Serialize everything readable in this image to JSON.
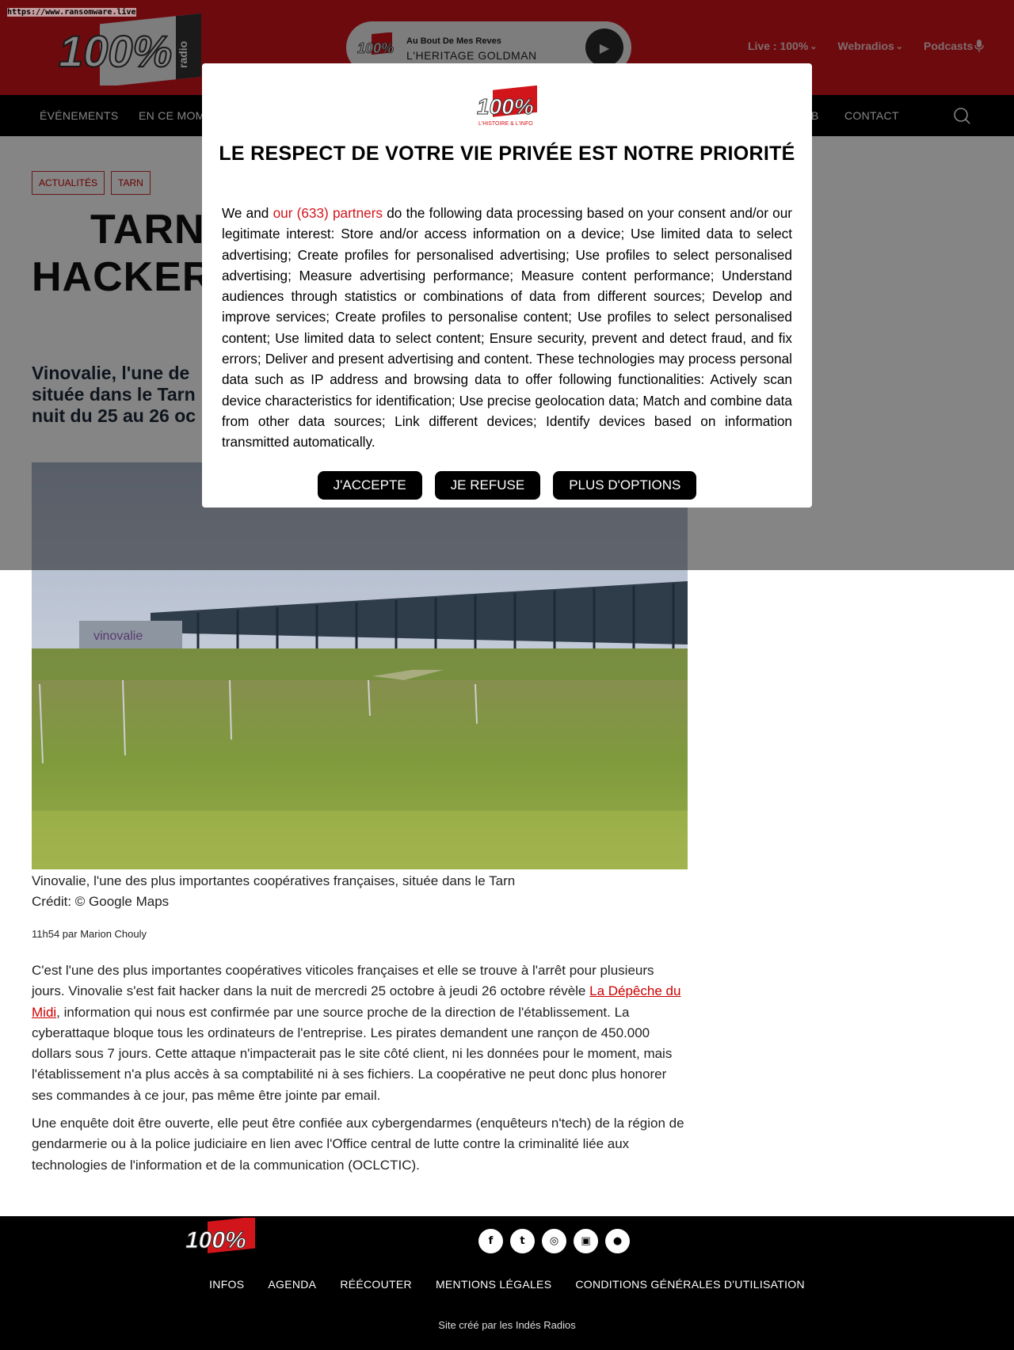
{
  "page": {
    "url_label": "https://www.ransomware.live"
  },
  "header": {
    "logo_text": "100%",
    "logo_sub": "radio",
    "player": {
      "logo_text": "100%",
      "song": "Au Bout De Mes Reves",
      "artist": "L'HERITAGE GOLDMAN",
      "play_symbol": "▶"
    },
    "links": [
      {
        "label": "Live : 100%",
        "icon": "chevron-down-icon"
      },
      {
        "label": "Webradios",
        "icon": "chevron-down-icon"
      },
      {
        "label": "Podcasts",
        "icon": "microphone-icon"
      }
    ]
  },
  "nav": {
    "items": [
      "ÉVÉNEMENTS",
      "EN CE MOM",
      "B",
      "CONTACT"
    ],
    "search_icon": "search-icon"
  },
  "article": {
    "tags": [
      "ACTUALITÉS",
      "TARN"
    ],
    "headline_lines": [
      "TARN. V",
      "HACKERS,"
    ],
    "lead_lines": [
      "Vinovalie, l'une de",
      "située dans le Tarn",
      "nuit du 25 au 26 oc"
    ],
    "photo_alt_label": "vinovalie",
    "caption": "Vinovalie, l'une des plus importantes coopératives françaises, située dans le Tarn",
    "credit": "Crédit: © Google Maps",
    "byline": "11h54 par Marion Chouly",
    "p1_a": "C'est l'une des plus importantes coopératives viticoles françaises et elle se trouve à l'arrêt pour plusieurs jours. Vinovalie s'est fait hacker dans la nuit de mercredi 25 octobre à jeudi 26 octobre révèle ",
    "p1_link": "La Dépêche du Midi",
    "p1_b": ", information qui nous est confirmée par une source proche de la direction de l'établissement. La cyberattaque bloque tous les ordinateurs de l'entreprise. Les pirates demandent une rançon de 450.000 dollars sous 7 jours. Cette attaque n'impacterait pas le site côté client, ni les données pour le moment, mais l'établissement n'a plus accès à sa comptabilité ni à ses fichiers. La coopérative ne peut donc plus honorer ses commandes à ce jour, pas même être jointe par email.",
    "p2": "Une enquête doit être ouverte, elle peut être confiée aux cybergendarmes (enquêteurs n'tech) de la région de gendarmerie ou à la police judiciaire en lien avec l'Office central de lutte contre la criminalité liée aux technologies de l'information et de la communication (OCLCTIC)."
  },
  "consent": {
    "logo_text": "100%",
    "logo_sub": "L'HISTOIRE & L'INFO",
    "title": "LE RESPECT DE VOTRE VIE PRIVÉE EST NOTRE PRIORITÉ",
    "text_before": "We and ",
    "partners_link": "our (633) partners",
    "text_after": " do the following data processing based on your consent and/or our legitimate interest: Store and/or access information on a device; Use limited data to select advertising; Create profiles for personalised advertising; Use profiles to select personalised advertising; Measure advertising performance; Measure content performance; Understand audiences through statistics or combinations of data from different sources; Develop and improve services; Create profiles to personalise content; Use profiles to select personalised content; Use limited data to select content; Ensure security, prevent and detect fraud, and fix errors; Deliver and present advertising and content. These technologies may process personal data such as IP address and browsing data to offer following functionalities: Actively scan device characteristics for identification; Use precise geolocation data; Match and combine data from other data sources; Link different devices; Identify devices based on information transmitted automatically.",
    "buttons": [
      "J'ACCEPTE",
      "JE REFUSE",
      "PLUS D'OPTIONS"
    ]
  },
  "footer": {
    "logo_text": "100%",
    "social": [
      {
        "icon": "facebook-icon",
        "glyph": "f"
      },
      {
        "icon": "twitter-icon",
        "glyph": "t"
      },
      {
        "icon": "instagram-icon",
        "glyph": "◎"
      },
      {
        "icon": "android-icon",
        "glyph": "▣"
      },
      {
        "icon": "apple-icon",
        "glyph": "●"
      }
    ],
    "links": [
      "INFOS",
      "AGENDA",
      "RÉÉCOUTER",
      "MENTIONS LÉGALES",
      "CONDITIONS GÉNÉRALES D'UTILISATION"
    ],
    "credit": "Site créé par les Indés Radios"
  },
  "colors": {
    "brand_red": "#d2151b",
    "nav_black": "#000000",
    "link_red": "#cc0000"
  }
}
